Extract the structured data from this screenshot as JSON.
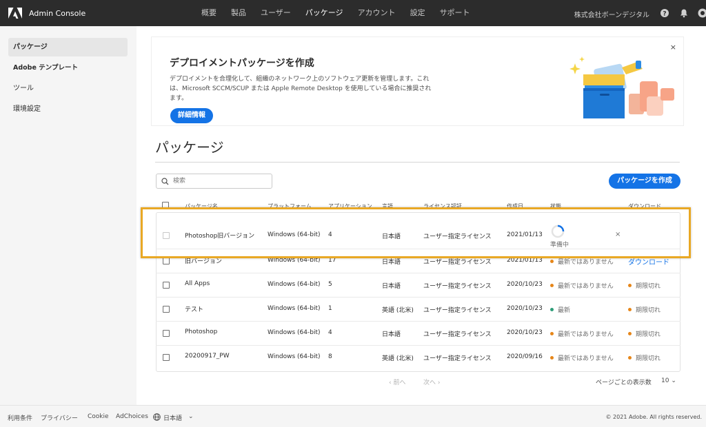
{
  "app": {
    "title": "Admin Console"
  },
  "nav": [
    "概要",
    "製品",
    "ユーザー",
    "パッケージ",
    "アカウント",
    "設定",
    "サポート"
  ],
  "nav_active": "パッケージ",
  "org_name": "株式会社ボーンデジタル",
  "sidebar": {
    "items": [
      "パッケージ",
      "Adobe テンプレート",
      "ツール",
      "環境設定"
    ]
  },
  "banner": {
    "title": "デプロイメントパッケージを作成",
    "description": "デプロイメントを合理化して、組織のネットワーク上のソフトウェア更新を管理します。これは、Microsoft SCCM/SCUP または Apple Remote Desktop を使用している場合に推奨されます。",
    "button": "詳細情報",
    "close": "×"
  },
  "page_title": "パッケージ",
  "search": {
    "placeholder": "検索"
  },
  "create_button": "パッケージを作成",
  "table": {
    "headers": [
      "パッケージ名",
      "プラットフォーム",
      "アプリケーション",
      "言語",
      "ライセンス認証",
      "作成日",
      "状態",
      "ダウンロード"
    ],
    "rows": [
      {
        "name": "Photoshop旧バージョン",
        "platform": "Windows (64-bit)",
        "apps": "4",
        "language": "日本語",
        "license": "ユーザー指定ライセンス",
        "date": "2021/01/13",
        "status": "準備中",
        "download": "×"
      },
      {
        "name": "旧バージョン",
        "platform": "Windows (64-bit)",
        "apps": "17",
        "language": "日本語",
        "license": "ユーザー指定ライセンス",
        "date": "2021/01/13",
        "status": "最新ではありません",
        "download": "ダウンロード"
      },
      {
        "name": "All Apps",
        "platform": "Windows (64-bit)",
        "apps": "5",
        "language": "日本語",
        "license": "ユーザー指定ライセンス",
        "date": "2020/10/23",
        "status": "最新ではありません",
        "download": "期限切れ"
      },
      {
        "name": "テスト",
        "platform": "Windows (64-bit)",
        "apps": "1",
        "language": "英語 (北米)",
        "license": "ユーザー指定ライセンス",
        "date": "2020/10/23",
        "status": "最新",
        "download": "期限切れ"
      },
      {
        "name": "Photoshop",
        "platform": "Windows (64-bit)",
        "apps": "4",
        "language": "日本語",
        "license": "ユーザー指定ライセンス",
        "date": "2020/10/23",
        "status": "最新ではありません",
        "download": "期限切れ"
      },
      {
        "name": "20200917_PW",
        "platform": "Windows (64-bit)",
        "apps": "8",
        "language": "英語 (北米)",
        "license": "ユーザー指定ライセンス",
        "date": "2020/09/16",
        "status": "最新ではありません",
        "download": "期限切れ"
      }
    ]
  },
  "pagination": {
    "prev": "‹ 前へ",
    "next": "次へ ›",
    "per_page_label": "ページごとの表示数",
    "per_page_value": "10"
  },
  "footer": {
    "terms": "利用条件",
    "privacy": "プライバシー",
    "cookie": "Cookie",
    "adchoices": "AdChoices",
    "language": "日本語",
    "copyright": "© 2021 Adobe. All rights reserved."
  },
  "colors": {
    "accent": "#1473e6",
    "topbar": "#2c2c2c",
    "status_orange": "#e68619",
    "status_green": "#2d9d78",
    "highlight": "#e9a824"
  }
}
